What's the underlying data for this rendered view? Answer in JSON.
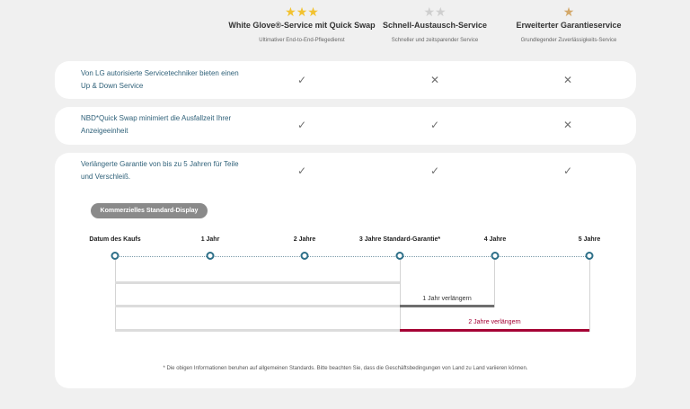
{
  "plans": [
    {
      "title": "White Glove®-Service mit Quick Swap",
      "subtitle": "Ultimativer End-to-End-Pflegedienst",
      "stars": 3,
      "star_color": "#f2c230"
    },
    {
      "title": "Schnell-Austausch-Service",
      "subtitle": "Schneller und zeitsparender Service",
      "stars": 2,
      "star_color": "#cfcfcf"
    },
    {
      "title": "Erweiterter Garantieservice",
      "subtitle": "Grundlegender Zuverlässigkeits-Service",
      "stars": 1,
      "star_color": "#d3a86a"
    }
  ],
  "features": [
    {
      "label": "Von LG autorisierte Servicetechniker bieten einen Up & Down Service",
      "marks": [
        "check",
        "cross",
        "cross"
      ]
    },
    {
      "label": "NBD*Quick Swap minimiert die Ausfallzeit Ihrer Anzeigeeinheit",
      "marks": [
        "check",
        "check",
        "cross"
      ]
    },
    {
      "label": "Verlängerte Garantie von bis zu 5 Jahren für Teile und Verschleiß.",
      "marks": [
        "check",
        "check",
        "check"
      ]
    }
  ],
  "timeline": {
    "pill": "Kommerzielles Standard-Display",
    "labels": [
      "Datum des Kaufs",
      "1 Jahr",
      "2 Jahre",
      "3 Jahre Standard-Garantie*",
      "4 Jahre",
      "5 Jahre"
    ],
    "ext1": "1 Jahr verlängern",
    "ext2": "2 Jahre verlängern"
  },
  "colors": {
    "accent_teal": "#2d6f88",
    "ext1": "#6e6e6e",
    "ext2": "#a50034"
  },
  "footnote": "* Die obigen Informationen beruhen auf allgemeinen Standards. Bitte beachten Sie, dass die Geschäftsbedingungen von Land zu Land variieren können."
}
